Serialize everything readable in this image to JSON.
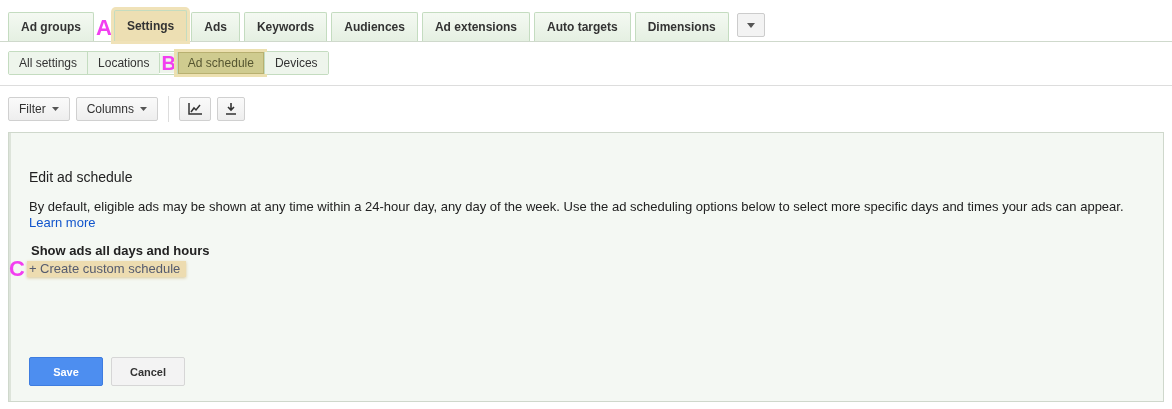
{
  "tabs": [
    {
      "label": "Ad groups",
      "selected": false,
      "highlighted": false
    },
    {
      "label": "Settings",
      "selected": true,
      "highlighted": true,
      "callout": "A"
    },
    {
      "label": "Ads",
      "selected": false,
      "highlighted": false
    },
    {
      "label": "Keywords",
      "selected": false,
      "highlighted": false
    },
    {
      "label": "Audiences",
      "selected": false,
      "highlighted": false
    },
    {
      "label": "Ad extensions",
      "selected": false,
      "highlighted": false
    },
    {
      "label": "Auto targets",
      "selected": false,
      "highlighted": false
    },
    {
      "label": "Dimensions",
      "selected": false,
      "highlighted": false
    }
  ],
  "subtabs": [
    {
      "label": "All settings",
      "selected": false,
      "highlighted": false
    },
    {
      "label": "Locations",
      "selected": false,
      "highlighted": false
    },
    {
      "label": "Ad schedule",
      "selected": true,
      "highlighted": true,
      "callout": "B"
    },
    {
      "label": "Devices",
      "selected": false,
      "highlighted": false
    }
  ],
  "toolbar": [
    {
      "kind": "dropdown",
      "label": "Filter"
    },
    {
      "kind": "dropdown",
      "label": "Columns"
    },
    {
      "kind": "separator"
    },
    {
      "kind": "chart"
    },
    {
      "kind": "download"
    }
  ],
  "panel": {
    "title": "Edit ad schedule",
    "description": "By default, eligible ads may be shown at any time within a 24-hour day, any day of the week. Use the ad scheduling options below to select more specific days and times your ads can appear.",
    "learn_more": "Learn more",
    "option_label": "Show ads all days and hours",
    "create_link": {
      "label": "+ Create custom schedule",
      "highlighted": true,
      "callout": "C"
    },
    "buttons": [
      {
        "label": "Save",
        "kind": "primary"
      },
      {
        "label": "Cancel",
        "kind": "secondary"
      }
    ]
  }
}
